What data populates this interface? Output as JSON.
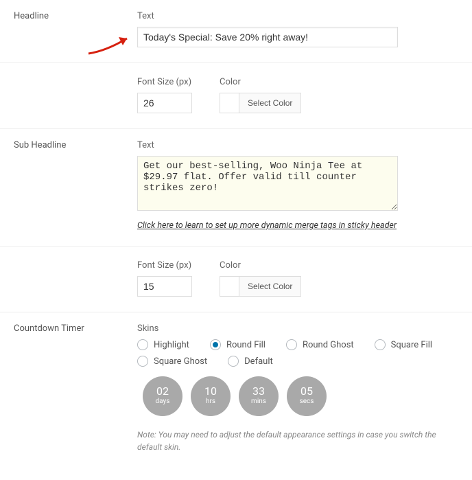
{
  "headline": {
    "section_label": "Headline",
    "text_label": "Text",
    "text_value": "Today's Special: Save 20% right away!",
    "fontsize_label": "Font Size (px)",
    "fontsize_value": "26",
    "color_label": "Color",
    "select_color_label": "Select Color"
  },
  "subheadline": {
    "section_label": "Sub Headline",
    "text_label": "Text",
    "text_value": "Get our best-selling, Woo Ninja Tee at $29.97 flat. Offer valid till counter strikes zero!",
    "help_link": "Click here to learn to set up more dynamic merge tags in sticky header",
    "fontsize_label": "Font Size (px)",
    "fontsize_value": "15",
    "color_label": "Color",
    "select_color_label": "Select Color"
  },
  "countdown": {
    "section_label": "Countdown Timer",
    "skins_label": "Skins",
    "skins": {
      "highlight": "Highlight",
      "round_fill": "Round Fill",
      "round_ghost": "Round Ghost",
      "square_fill": "Square Fill",
      "square_ghost": "Square Ghost",
      "default": "Default"
    },
    "selected_skin": "round_fill",
    "timer": {
      "days_value": "02",
      "days_unit": "days",
      "hrs_value": "10",
      "hrs_unit": "hrs",
      "mins_value": "33",
      "mins_unit": "mins",
      "secs_value": "05",
      "secs_unit": "secs"
    },
    "note": "Note: You may need to adjust the default appearance settings in case you switch the default skin."
  }
}
